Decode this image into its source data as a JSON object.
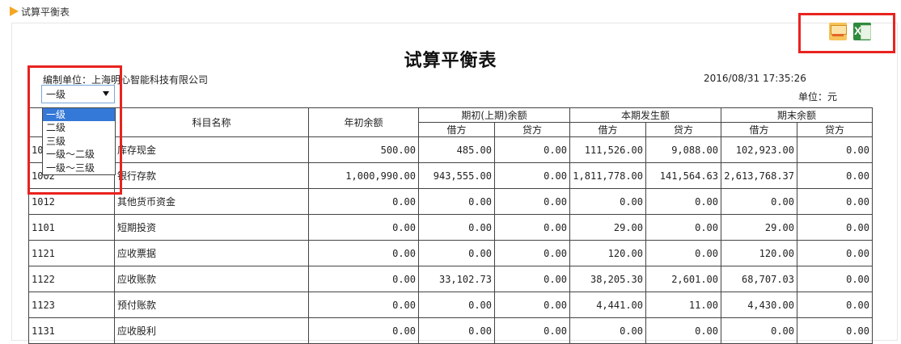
{
  "breadcrumb": {
    "label": "试算平衡表"
  },
  "report": {
    "title": "试算平衡表",
    "company": "编制单位：上海明心智能科技有限公司",
    "timestamp": "2016/08/31 17:35:26",
    "unit": "单位：元"
  },
  "toolbar": {
    "icons": [
      "mail-icon",
      "excel-icon"
    ]
  },
  "level_select": {
    "value": "一级",
    "options": [
      "一级",
      "二级",
      "三级",
      "一级～二级",
      "一级～三级"
    ],
    "highlighted": "一级"
  },
  "colors": {
    "highlight_box": "#e8231f",
    "selection": "#3478d8",
    "breadcrumb_arrow": "#f5a623"
  },
  "table": {
    "headers": {
      "code": "",
      "name": "科目名称",
      "opening": "年初余额",
      "period_start": "期初(上期)余额",
      "period_change": "本期发生额",
      "period_end": "期末余额",
      "debit": "借方",
      "credit": "贷方"
    },
    "rows": [
      {
        "code": "10",
        "name": "库存现金",
        "opening": "500.00",
        "start_debit": "485.00",
        "start_credit": "0.00",
        "change_debit": "111,526.00",
        "change_credit": "9,088.00",
        "end_debit": "102,923.00",
        "end_credit": "0.00"
      },
      {
        "code": "1002",
        "name": "银行存款",
        "opening": "1,000,990.00",
        "start_debit": "943,555.00",
        "start_credit": "0.00",
        "change_debit": "1,811,778.00",
        "change_credit": "141,564.63",
        "end_debit": "2,613,768.37",
        "end_credit": "0.00"
      },
      {
        "code": "1012",
        "name": "其他货币资金",
        "opening": "0.00",
        "start_debit": "0.00",
        "start_credit": "0.00",
        "change_debit": "0.00",
        "change_credit": "0.00",
        "end_debit": "0.00",
        "end_credit": "0.00"
      },
      {
        "code": "1101",
        "name": "短期投资",
        "opening": "0.00",
        "start_debit": "0.00",
        "start_credit": "0.00",
        "change_debit": "29.00",
        "change_credit": "0.00",
        "end_debit": "29.00",
        "end_credit": "0.00"
      },
      {
        "code": "1121",
        "name": "应收票据",
        "opening": "0.00",
        "start_debit": "0.00",
        "start_credit": "0.00",
        "change_debit": "120.00",
        "change_credit": "0.00",
        "end_debit": "120.00",
        "end_credit": "0.00"
      },
      {
        "code": "1122",
        "name": "应收账款",
        "opening": "0.00",
        "start_debit": "33,102.73",
        "start_credit": "0.00",
        "change_debit": "38,205.30",
        "change_credit": "2,601.00",
        "end_debit": "68,707.03",
        "end_credit": "0.00"
      },
      {
        "code": "1123",
        "name": "预付账款",
        "opening": "0.00",
        "start_debit": "0.00",
        "start_credit": "0.00",
        "change_debit": "4,441.00",
        "change_credit": "11.00",
        "end_debit": "4,430.00",
        "end_credit": "0.00"
      },
      {
        "code": "1131",
        "name": "应收股利",
        "opening": "0.00",
        "start_debit": "0.00",
        "start_credit": "0.00",
        "change_debit": "0.00",
        "change_credit": "0.00",
        "end_debit": "0.00",
        "end_credit": "0.00"
      }
    ]
  }
}
